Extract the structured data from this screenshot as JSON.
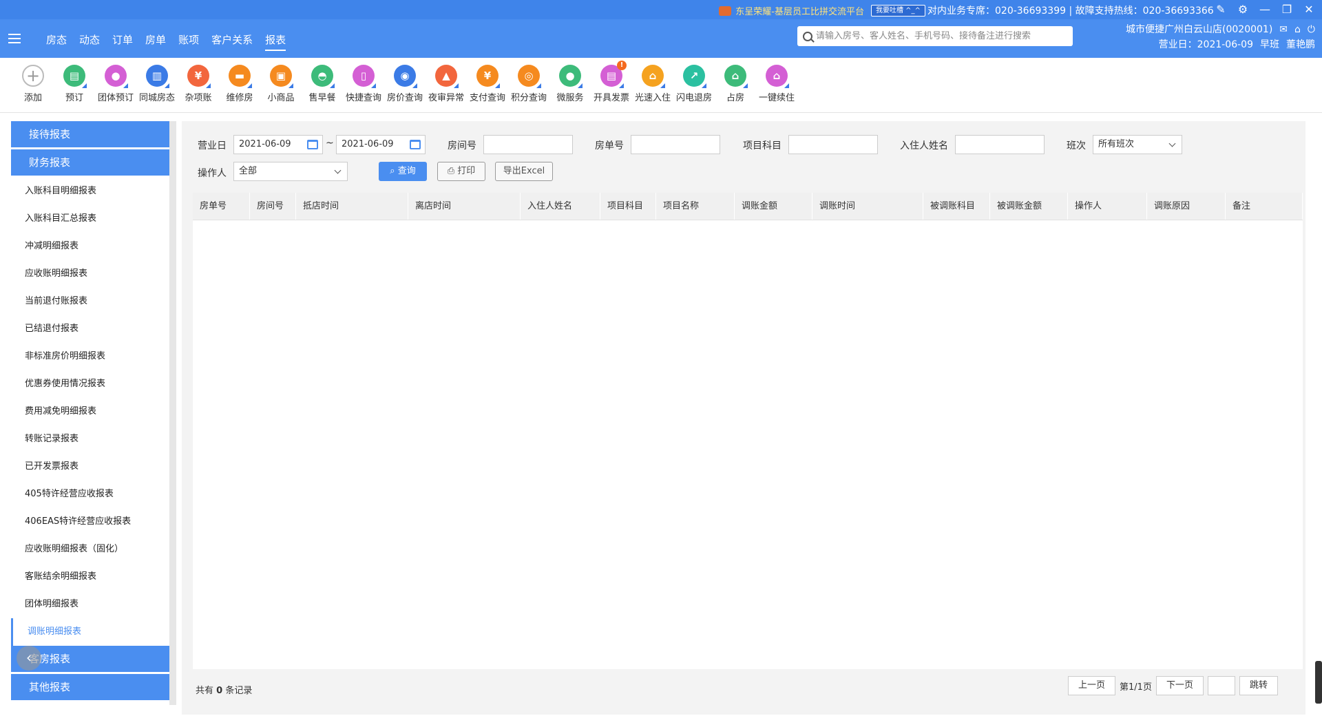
{
  "header": {
    "platform_text": "东呈荣耀-基层员工比拼交流平台",
    "complain_label": "我要吐槽 ^_^",
    "hotline_text": "对内业务专席：020-36693399 | 故障支持热线：020-36693366",
    "store_name": "城市便捷广州白云山店(0020001)",
    "business_day": "营业日：2021-06-09",
    "shift": "早班",
    "user": "董艳鹏"
  },
  "nav": {
    "items": [
      "房态",
      "动态",
      "订单",
      "房单",
      "账项",
      "客户关系",
      "报表"
    ],
    "active_index": 6
  },
  "search": {
    "placeholder": "请输入房号、客人姓名、手机号码、接待备注进行搜索"
  },
  "toolbar": {
    "items": [
      {
        "label": "添加",
        "icon": "plus-icon",
        "color": "#ffffff"
      },
      {
        "label": "预订",
        "icon": "booking-icon",
        "color": "#3dbb7a"
      },
      {
        "label": "团体预订",
        "icon": "group-icon",
        "color": "#d45fd4"
      },
      {
        "label": "同城房态",
        "icon": "building-icon",
        "color": "#3b7be6"
      },
      {
        "label": "杂项账",
        "icon": "misc-bill-icon",
        "color": "#f2663d"
      },
      {
        "label": "维修房",
        "icon": "repair-icon",
        "color": "#f58a1f"
      },
      {
        "label": "小商品",
        "icon": "shop-icon",
        "color": "#f58a1f"
      },
      {
        "label": "售早餐",
        "icon": "breakfast-icon",
        "color": "#3dbb7a"
      },
      {
        "label": "快捷查询",
        "icon": "phone-icon",
        "color": "#d45fd4"
      },
      {
        "label": "房价查询",
        "icon": "price-icon",
        "color": "#3b7be6"
      },
      {
        "label": "夜审异常",
        "icon": "alarm-icon",
        "color": "#f2663d"
      },
      {
        "label": "支付查询",
        "icon": "yen-icon",
        "color": "#f58a1f"
      },
      {
        "label": "积分查询",
        "icon": "points-icon",
        "color": "#f58a1f"
      },
      {
        "label": "微服务",
        "icon": "wechat-icon",
        "color": "#3dbb7a"
      },
      {
        "label": "开具发票",
        "icon": "invoice-icon",
        "color": "#d45fd4"
      },
      {
        "label": "光速入住",
        "icon": "checkin-icon",
        "color": "#f5a21f"
      },
      {
        "label": "闪电退房",
        "icon": "checkout-icon",
        "color": "#2bc0a0"
      },
      {
        "label": "占房",
        "icon": "occupy-icon",
        "color": "#3dbb7a"
      },
      {
        "label": "一键续住",
        "icon": "extend-icon",
        "color": "#d45fd4"
      }
    ],
    "badge": "!"
  },
  "sidebar": {
    "groups": [
      {
        "label": "接待报表"
      },
      {
        "label": "财务报表"
      }
    ],
    "items": [
      "入账科目明细报表",
      "入账科目汇总报表",
      "冲减明细报表",
      "应收账明细报表",
      "当前退付账报表",
      "已结退付报表",
      "非标准房价明细报表",
      "优惠券使用情况报表",
      "费用减免明细报表",
      "转账记录报表",
      "已开发票报表",
      "405特许经营应收报表",
      "406EAS特许经营应收报表",
      "应收账明细报表（固化）",
      "客账结余明细报表",
      "团体明细报表",
      "调账明细报表"
    ],
    "active_item": 16,
    "bottom_groups": [
      {
        "label": "客房报表"
      },
      {
        "label": "其他报表"
      }
    ]
  },
  "filters": {
    "business_day_label": "营业日",
    "date_from": "2021-06-09",
    "date_sep": "~",
    "date_to": "2021-06-09",
    "room_no_label": "房间号",
    "order_no_label": "房单号",
    "item_subject_label": "项目科目",
    "guest_name_label": "入住人姓名",
    "shift_label": "班次",
    "shift_value": "所有班次",
    "operator_label": "操作人",
    "operator_value": "全部",
    "query_label": "查询",
    "print_label": "打印",
    "export_label": "导出Excel"
  },
  "table": {
    "columns": [
      "房单号",
      "房间号",
      "抵店时间",
      "离店时间",
      "入住人姓名",
      "项目科目",
      "项目名称",
      "调账金额",
      "调账时间",
      "被调账科目",
      "被调账金额",
      "操作人",
      "调账原因",
      "备注"
    ],
    "rows": []
  },
  "footer": {
    "total_prefix": "共有",
    "total_count": "0",
    "total_suffix": "条记录",
    "prev_label": "上一页",
    "page_text": "第1/1页",
    "next_label": "下一页",
    "jump_label": "跳转"
  }
}
